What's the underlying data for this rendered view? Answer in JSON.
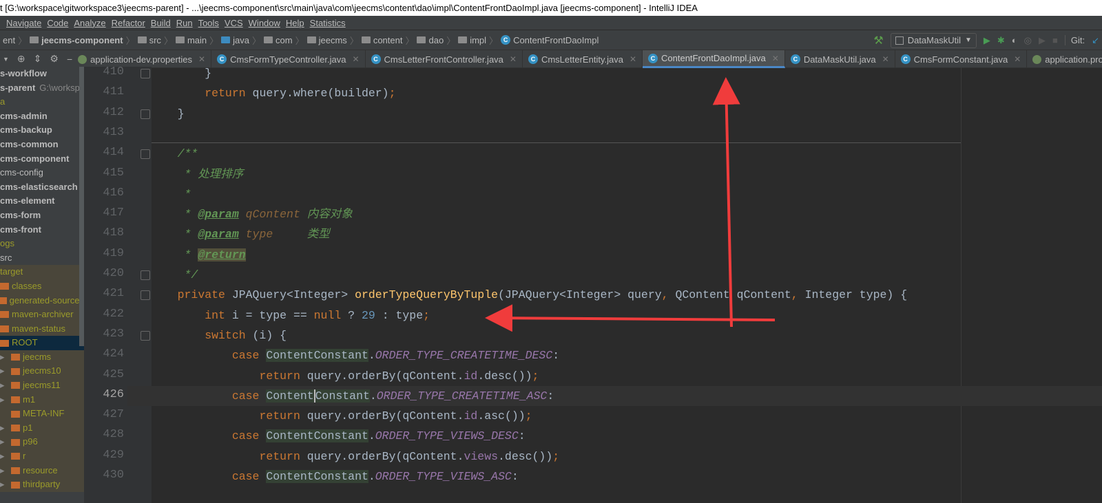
{
  "window": {
    "title": "t [G:\\workspace\\gitworkspace3\\jeecms-parent] - ...\\jeecms-component\\src\\main\\java\\com\\jeecms\\content\\dao\\impl\\ContentFrontDaoImpl.java [jeecms-component] - IntelliJ IDEA"
  },
  "menu": [
    "Navigate",
    "Code",
    "Analyze",
    "Refactor",
    "Build",
    "Run",
    "Tools",
    "VCS",
    "Window",
    "Help",
    "Statistics"
  ],
  "breadcrumb": [
    "ent",
    "jeecms-component",
    "src",
    "main",
    "java",
    "com",
    "jeecms",
    "content",
    "dao",
    "impl",
    "ContentFrontDaoImpl"
  ],
  "toolbar": {
    "run_config": "DataMaskUtil",
    "git_label": "Git:"
  },
  "tabs": [
    {
      "label": "application-dev.properties",
      "icon": "spring"
    },
    {
      "label": "CmsFormTypeController.java",
      "icon": "class"
    },
    {
      "label": "CmsLetterFrontController.java",
      "icon": "class"
    },
    {
      "label": "CmsLetterEntity.java",
      "icon": "class"
    },
    {
      "label": "ContentFrontDaoImpl.java",
      "icon": "class",
      "active": true
    },
    {
      "label": "DataMaskUtil.java",
      "icon": "class-run"
    },
    {
      "label": "CmsFormConstant.java",
      "icon": "class"
    },
    {
      "label": "application.prope",
      "icon": "spring"
    }
  ],
  "project_tree": [
    {
      "label": "s-workflow",
      "style": "b",
      "indent": 0
    },
    {
      "label": "s-parent",
      "extra": "G:\\workspac",
      "style": "b",
      "indent": 0
    },
    {
      "label": "a",
      "style": "ex0",
      "indent": 0
    },
    {
      "label": "cms-admin",
      "style": "b",
      "indent": 0
    },
    {
      "label": "cms-backup",
      "style": "b",
      "indent": 0
    },
    {
      "label": "cms-common",
      "style": "b",
      "indent": 0
    },
    {
      "label": "cms-component",
      "style": "b",
      "indent": 0
    },
    {
      "label": "cms-config",
      "style": "",
      "indent": 0
    },
    {
      "label": "cms-elasticsearch",
      "style": "b",
      "indent": 0
    },
    {
      "label": "cms-element",
      "style": "b",
      "indent": 0
    },
    {
      "label": "cms-form",
      "style": "b",
      "indent": 0
    },
    {
      "label": "cms-front",
      "style": "b",
      "indent": 0
    },
    {
      "label": "ogs",
      "style": "ex0",
      "indent": 0
    },
    {
      "label": "src",
      "style": "",
      "indent": 0
    },
    {
      "label": "target",
      "style": "ex",
      "indent": 0
    },
    {
      "label": "classes",
      "style": "ex",
      "indent": 1
    },
    {
      "label": "generated-sources",
      "style": "ex",
      "indent": 1
    },
    {
      "label": "maven-archiver",
      "style": "ex",
      "indent": 1
    },
    {
      "label": "maven-status",
      "style": "ex",
      "indent": 1
    },
    {
      "label": "ROOT",
      "style": "sel",
      "indent": 1
    },
    {
      "label": "jeecms",
      "style": "ex",
      "indent": 2,
      "arrow": true
    },
    {
      "label": "jeecms10",
      "style": "ex",
      "indent": 2,
      "arrow": true
    },
    {
      "label": "jeecms11",
      "style": "ex",
      "indent": 2,
      "arrow": true
    },
    {
      "label": "m1",
      "style": "ex",
      "indent": 2,
      "arrow": true
    },
    {
      "label": "META-INF",
      "style": "ex",
      "indent": 2
    },
    {
      "label": "p1",
      "style": "ex",
      "indent": 2,
      "arrow": true
    },
    {
      "label": "p96",
      "style": "ex",
      "indent": 2,
      "arrow": true
    },
    {
      "label": "r",
      "style": "ex",
      "indent": 2,
      "arrow": true
    },
    {
      "label": "resource",
      "style": "ex",
      "indent": 2,
      "arrow": true
    },
    {
      "label": "thirdparty",
      "style": "ex",
      "indent": 2,
      "arrow": true
    }
  ],
  "editor": {
    "current_line": 426,
    "lines": [
      {
        "n": 410,
        "t": [
          [
            "        }",
            ""
          ]
        ]
      },
      {
        "n": 411,
        "t": [
          [
            "        ",
            ""
          ],
          [
            "return",
            "kw"
          ],
          [
            " query.where(builder)",
            ""
          ],
          [
            ";",
            "kw"
          ]
        ]
      },
      {
        "n": 412,
        "t": [
          [
            "    }",
            ""
          ]
        ]
      },
      {
        "n": 413,
        "t": []
      },
      {
        "n": 414,
        "t": [
          [
            "    /**",
            "doc"
          ]
        ]
      },
      {
        "n": 415,
        "t": [
          [
            "     * 处理排序",
            "doc"
          ]
        ]
      },
      {
        "n": 416,
        "t": [
          [
            "     *",
            "doc"
          ]
        ]
      },
      {
        "n": 417,
        "t": [
          [
            "     * ",
            "doc"
          ],
          [
            "@param",
            "tag"
          ],
          [
            " qContent ",
            "pname"
          ],
          [
            "内容对象",
            "doc"
          ]
        ]
      },
      {
        "n": 418,
        "t": [
          [
            "     * ",
            "doc"
          ],
          [
            "@param",
            "tag"
          ],
          [
            " type     ",
            "pname"
          ],
          [
            "类型",
            "doc"
          ]
        ]
      },
      {
        "n": 419,
        "t": [
          [
            "     * ",
            "doc"
          ],
          [
            "@return",
            "tag hl"
          ]
        ]
      },
      {
        "n": 420,
        "t": [
          [
            "     */",
            "doc"
          ]
        ]
      },
      {
        "n": 421,
        "t": [
          [
            "    ",
            ""
          ],
          [
            "private ",
            "kw"
          ],
          [
            "JPAQuery<Integer> ",
            ""
          ],
          [
            "orderTypeQueryByTuple",
            "fn"
          ],
          [
            "(JPAQuery<Integer> query",
            ""
          ],
          [
            ", ",
            "kw"
          ],
          [
            "QContent qContent",
            ""
          ],
          [
            ", ",
            "kw"
          ],
          [
            "Integer type) {",
            ""
          ]
        ]
      },
      {
        "n": 422,
        "t": [
          [
            "        ",
            ""
          ],
          [
            "int ",
            "kw"
          ],
          [
            "i = type == ",
            ""
          ],
          [
            "null ",
            "kw"
          ],
          [
            "? ",
            ""
          ],
          [
            "29",
            "num"
          ],
          [
            " : type",
            ""
          ],
          [
            ";",
            "kw"
          ]
        ]
      },
      {
        "n": 423,
        "t": [
          [
            "        ",
            ""
          ],
          [
            "switch ",
            "kw"
          ],
          [
            "(i) {",
            ""
          ]
        ]
      },
      {
        "n": 424,
        "t": [
          [
            "            ",
            ""
          ],
          [
            "case ",
            "kw"
          ],
          [
            "ContentConstant",
            "cls"
          ],
          [
            ".",
            ""
          ],
          [
            "ORDER_TYPE_CREATETIME_DESC",
            "const"
          ],
          [
            ":",
            ""
          ]
        ]
      },
      {
        "n": 425,
        "t": [
          [
            "                ",
            ""
          ],
          [
            "return ",
            "kw"
          ],
          [
            "query.orderBy(qContent.",
            ""
          ],
          [
            "id",
            "field"
          ],
          [
            ".desc())",
            ""
          ],
          [
            ";",
            "kw"
          ]
        ]
      },
      {
        "n": 426,
        "t": [
          [
            "            ",
            ""
          ],
          [
            "case ",
            "kw"
          ],
          [
            "Content",
            "cls"
          ],
          [
            "Constant",
            "cls caret"
          ],
          [
            ".",
            ""
          ],
          [
            "ORDER_TYPE_CREATETIME_ASC",
            "const"
          ],
          [
            ":",
            ""
          ]
        ]
      },
      {
        "n": 427,
        "t": [
          [
            "                ",
            ""
          ],
          [
            "return ",
            "kw"
          ],
          [
            "query.orderBy(qContent.",
            ""
          ],
          [
            "id",
            "field"
          ],
          [
            ".asc())",
            ""
          ],
          [
            ";",
            "kw"
          ]
        ]
      },
      {
        "n": 428,
        "t": [
          [
            "            ",
            ""
          ],
          [
            "case ",
            "kw"
          ],
          [
            "ContentConstant",
            "cls"
          ],
          [
            ".",
            ""
          ],
          [
            "ORDER_TYPE_VIEWS_DESC",
            "const"
          ],
          [
            ":",
            ""
          ]
        ]
      },
      {
        "n": 429,
        "t": [
          [
            "                ",
            ""
          ],
          [
            "return ",
            "kw"
          ],
          [
            "query.orderBy(qContent.",
            ""
          ],
          [
            "views",
            "field"
          ],
          [
            ".desc())",
            ""
          ],
          [
            ";",
            "kw"
          ]
        ]
      },
      {
        "n": 430,
        "t": [
          [
            "            ",
            ""
          ],
          [
            "case ",
            "kw"
          ],
          [
            "ContentConstant",
            "cls"
          ],
          [
            ".",
            ""
          ],
          [
            "ORDER_TYPE_VIEWS_ASC",
            "const"
          ],
          [
            ":",
            ""
          ]
        ]
      }
    ]
  },
  "colors": {
    "annotation_arrow": "#f03c3c",
    "accent": "#4a88c7"
  }
}
